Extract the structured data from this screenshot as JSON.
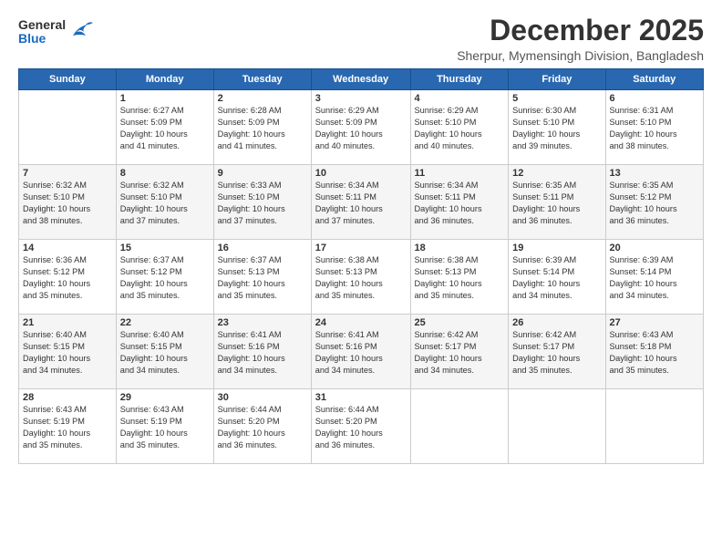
{
  "logo": {
    "general": "General",
    "blue": "Blue"
  },
  "header": {
    "month": "December 2025",
    "location": "Sherpur, Mymensingh Division, Bangladesh"
  },
  "weekdays": [
    "Sunday",
    "Monday",
    "Tuesday",
    "Wednesday",
    "Thursday",
    "Friday",
    "Saturday"
  ],
  "weeks": [
    [
      {
        "day": "",
        "info": ""
      },
      {
        "day": "1",
        "info": "Sunrise: 6:27 AM\nSunset: 5:09 PM\nDaylight: 10 hours\nand 41 minutes."
      },
      {
        "day": "2",
        "info": "Sunrise: 6:28 AM\nSunset: 5:09 PM\nDaylight: 10 hours\nand 41 minutes."
      },
      {
        "day": "3",
        "info": "Sunrise: 6:29 AM\nSunset: 5:09 PM\nDaylight: 10 hours\nand 40 minutes."
      },
      {
        "day": "4",
        "info": "Sunrise: 6:29 AM\nSunset: 5:10 PM\nDaylight: 10 hours\nand 40 minutes."
      },
      {
        "day": "5",
        "info": "Sunrise: 6:30 AM\nSunset: 5:10 PM\nDaylight: 10 hours\nand 39 minutes."
      },
      {
        "day": "6",
        "info": "Sunrise: 6:31 AM\nSunset: 5:10 PM\nDaylight: 10 hours\nand 38 minutes."
      }
    ],
    [
      {
        "day": "7",
        "info": "Sunrise: 6:32 AM\nSunset: 5:10 PM\nDaylight: 10 hours\nand 38 minutes."
      },
      {
        "day": "8",
        "info": "Sunrise: 6:32 AM\nSunset: 5:10 PM\nDaylight: 10 hours\nand 37 minutes."
      },
      {
        "day": "9",
        "info": "Sunrise: 6:33 AM\nSunset: 5:10 PM\nDaylight: 10 hours\nand 37 minutes."
      },
      {
        "day": "10",
        "info": "Sunrise: 6:34 AM\nSunset: 5:11 PM\nDaylight: 10 hours\nand 37 minutes."
      },
      {
        "day": "11",
        "info": "Sunrise: 6:34 AM\nSunset: 5:11 PM\nDaylight: 10 hours\nand 36 minutes."
      },
      {
        "day": "12",
        "info": "Sunrise: 6:35 AM\nSunset: 5:11 PM\nDaylight: 10 hours\nand 36 minutes."
      },
      {
        "day": "13",
        "info": "Sunrise: 6:35 AM\nSunset: 5:12 PM\nDaylight: 10 hours\nand 36 minutes."
      }
    ],
    [
      {
        "day": "14",
        "info": "Sunrise: 6:36 AM\nSunset: 5:12 PM\nDaylight: 10 hours\nand 35 minutes."
      },
      {
        "day": "15",
        "info": "Sunrise: 6:37 AM\nSunset: 5:12 PM\nDaylight: 10 hours\nand 35 minutes."
      },
      {
        "day": "16",
        "info": "Sunrise: 6:37 AM\nSunset: 5:13 PM\nDaylight: 10 hours\nand 35 minutes."
      },
      {
        "day": "17",
        "info": "Sunrise: 6:38 AM\nSunset: 5:13 PM\nDaylight: 10 hours\nand 35 minutes."
      },
      {
        "day": "18",
        "info": "Sunrise: 6:38 AM\nSunset: 5:13 PM\nDaylight: 10 hours\nand 35 minutes."
      },
      {
        "day": "19",
        "info": "Sunrise: 6:39 AM\nSunset: 5:14 PM\nDaylight: 10 hours\nand 34 minutes."
      },
      {
        "day": "20",
        "info": "Sunrise: 6:39 AM\nSunset: 5:14 PM\nDaylight: 10 hours\nand 34 minutes."
      }
    ],
    [
      {
        "day": "21",
        "info": "Sunrise: 6:40 AM\nSunset: 5:15 PM\nDaylight: 10 hours\nand 34 minutes."
      },
      {
        "day": "22",
        "info": "Sunrise: 6:40 AM\nSunset: 5:15 PM\nDaylight: 10 hours\nand 34 minutes."
      },
      {
        "day": "23",
        "info": "Sunrise: 6:41 AM\nSunset: 5:16 PM\nDaylight: 10 hours\nand 34 minutes."
      },
      {
        "day": "24",
        "info": "Sunrise: 6:41 AM\nSunset: 5:16 PM\nDaylight: 10 hours\nand 34 minutes."
      },
      {
        "day": "25",
        "info": "Sunrise: 6:42 AM\nSunset: 5:17 PM\nDaylight: 10 hours\nand 34 minutes."
      },
      {
        "day": "26",
        "info": "Sunrise: 6:42 AM\nSunset: 5:17 PM\nDaylight: 10 hours\nand 35 minutes."
      },
      {
        "day": "27",
        "info": "Sunrise: 6:43 AM\nSunset: 5:18 PM\nDaylight: 10 hours\nand 35 minutes."
      }
    ],
    [
      {
        "day": "28",
        "info": "Sunrise: 6:43 AM\nSunset: 5:19 PM\nDaylight: 10 hours\nand 35 minutes."
      },
      {
        "day": "29",
        "info": "Sunrise: 6:43 AM\nSunset: 5:19 PM\nDaylight: 10 hours\nand 35 minutes."
      },
      {
        "day": "30",
        "info": "Sunrise: 6:44 AM\nSunset: 5:20 PM\nDaylight: 10 hours\nand 36 minutes."
      },
      {
        "day": "31",
        "info": "Sunrise: 6:44 AM\nSunset: 5:20 PM\nDaylight: 10 hours\nand 36 minutes."
      },
      {
        "day": "",
        "info": ""
      },
      {
        "day": "",
        "info": ""
      },
      {
        "day": "",
        "info": ""
      }
    ]
  ]
}
